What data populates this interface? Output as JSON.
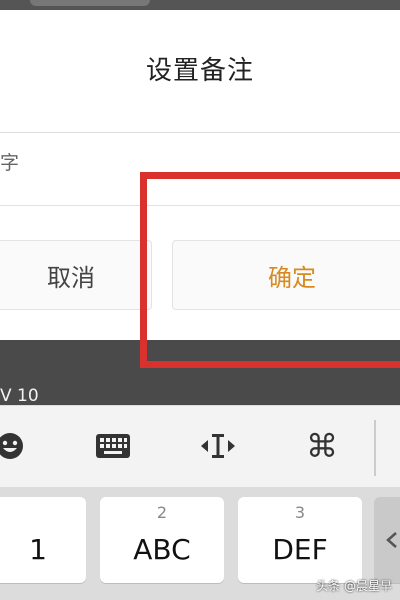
{
  "dialog": {
    "title": "设置备注",
    "input_text": "字",
    "cancel_label": "取消",
    "confirm_label": "确定",
    "accent_color": "#d98a1f",
    "highlight_color": "#d8312e"
  },
  "underlay": {
    "text": "V 10"
  },
  "keyboard": {
    "toolbar_icons": [
      "emoji-icon",
      "keyboard-icon",
      "cursor-move-icon",
      "command-icon"
    ],
    "keys": [
      {
        "sup": "",
        "main": "1"
      },
      {
        "sup": "2",
        "main": "ABC"
      },
      {
        "sup": "3",
        "main": "DEF"
      }
    ]
  },
  "watermark": "头条 @晨星早"
}
